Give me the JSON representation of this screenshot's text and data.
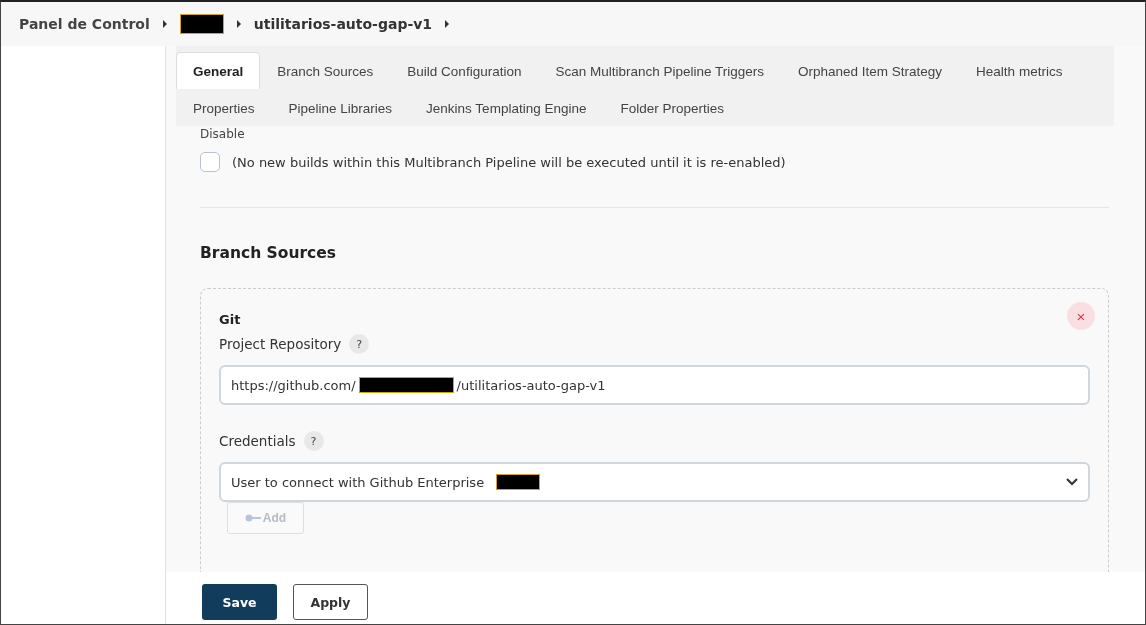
{
  "breadcrumbs": [
    {
      "label": "Panel de Control",
      "redacted": false
    },
    {
      "redacted": true
    },
    {
      "label": "utilitarios-auto-gap-v1",
      "redacted": false
    }
  ],
  "tabs": [
    {
      "label": "General",
      "selected": true
    },
    {
      "label": "Branch Sources",
      "selected": false
    },
    {
      "label": "Build Configuration",
      "selected": false
    },
    {
      "label": "Scan Multibranch Pipeline Triggers",
      "selected": false
    },
    {
      "label": "Orphaned Item Strategy",
      "selected": false
    },
    {
      "label": "Health metrics",
      "selected": false
    },
    {
      "label": "Properties",
      "selected": false
    },
    {
      "label": "Pipeline Libraries",
      "selected": false
    },
    {
      "label": "Jenkins Templating Engine",
      "selected": false
    },
    {
      "label": "Folder Properties",
      "selected": false
    }
  ],
  "disable": {
    "label": "Disable",
    "checked": false,
    "description": "(No new builds within this Multibranch Pipeline will be executed until it is re-enabled)"
  },
  "branch_sources": {
    "title": "Branch Sources",
    "source": {
      "type": "Git",
      "repository_label": "Project Repository",
      "help": "?",
      "repository_prefix": "https://github.com/",
      "repository_suffix": "/utilitarios-auto-gap-v1",
      "credentials_label": "Credentials",
      "credentials_help": "?",
      "credentials_value": "User to connect with Github Enterprise",
      "add_button": "Add",
      "close": "×"
    }
  },
  "buttons": [
    {
      "label": "Save",
      "kind": "primary"
    },
    {
      "label": "Apply",
      "kind": "secondary"
    }
  ]
}
